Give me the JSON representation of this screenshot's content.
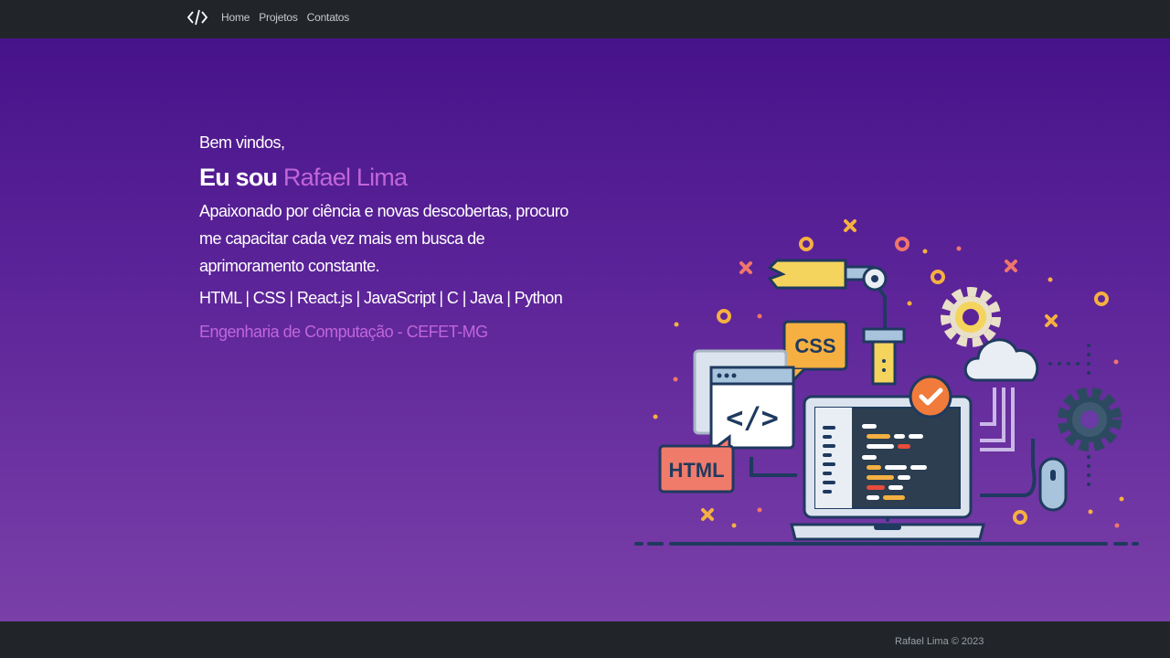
{
  "nav": {
    "brand_icon": "code-brackets-icon",
    "links": [
      "Home",
      "Projetos",
      "Contatos"
    ]
  },
  "hero": {
    "welcome": "Bem vindos,",
    "title_prefix": "Eu sou",
    "title_name": "Rafael Lima",
    "description": "Apaixonado por ciência e novas descobertas, procuro me capacitar cada vez mais em busca de aprimoramento constante.",
    "skills": "HTML | CSS | React.js | JavaScript | C | Java | Python",
    "course": "Engenharia de Computação - CEFET-MG",
    "illustration": {
      "css_tag": "CSS",
      "html_tag": "HTML",
      "code_glyph": "</>"
    }
  },
  "footer": {
    "text": "Rafael Lima © 2023"
  },
  "colors": {
    "navbar": "#212529",
    "hero_top": "#47138a",
    "hero_bottom": "#7a3fa8",
    "accent": "#c066d8",
    "footer_text": "#9aa0a6"
  }
}
